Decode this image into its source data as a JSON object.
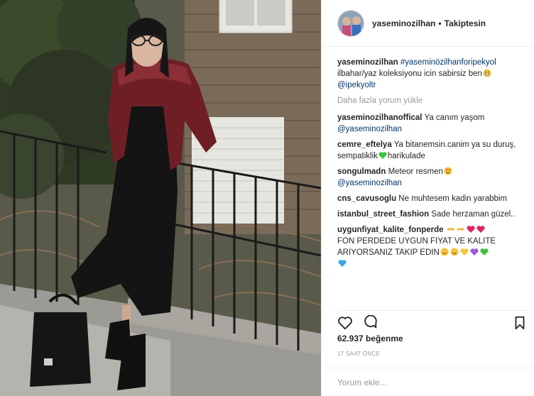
{
  "post": {
    "username": "yaseminozilhan",
    "separator": "•",
    "follow_state": "Takiptesin"
  },
  "caption": {
    "user": "yaseminozilhan",
    "hashtag": "#yaseminözilhanforipekyol",
    "text": "ilbahar/yaz koleksiyonu icin sabirsiz ben",
    "mention": "@ipekyoltr"
  },
  "load_more": "Daha fazla yorum yükle",
  "comments": [
    {
      "user": "yaseminozilhanoffical",
      "text": "Ya canım yaşom",
      "mention": "@yaseminozilhan"
    },
    {
      "user": "cemre_eftelya",
      "text": "Ya bitanemsin.canim ya su duruş, sempatiklik",
      "text2": "harikulade"
    },
    {
      "user": "songulmadn",
      "text": "Meteor resmen",
      "mention": "@yaseminozilhan"
    },
    {
      "user": "cns_cavusoglu",
      "text": "Ne muhtesem kadin yarabbim"
    },
    {
      "user": "istanbul_street_fashion",
      "text": "Sade herzaman güzel.."
    },
    {
      "user": "uygunfiyat_kalite_fonperde",
      "text": "FON PERDEDE UYGUN FIYAT VE KALITE ARIYORSANIZ TAKIP EDIN"
    }
  ],
  "likes": "62.937 beğenme",
  "time": "17 SAAT ÖNCE",
  "comment_input": {
    "placeholder": "Yorum ekle..."
  },
  "icons": [
    "heart-icon",
    "comment-icon",
    "bookmark-icon"
  ],
  "colors": {
    "link": "#003569",
    "muted": "#999999",
    "border": "#efefef",
    "jacket": "#6e1f26"
  }
}
